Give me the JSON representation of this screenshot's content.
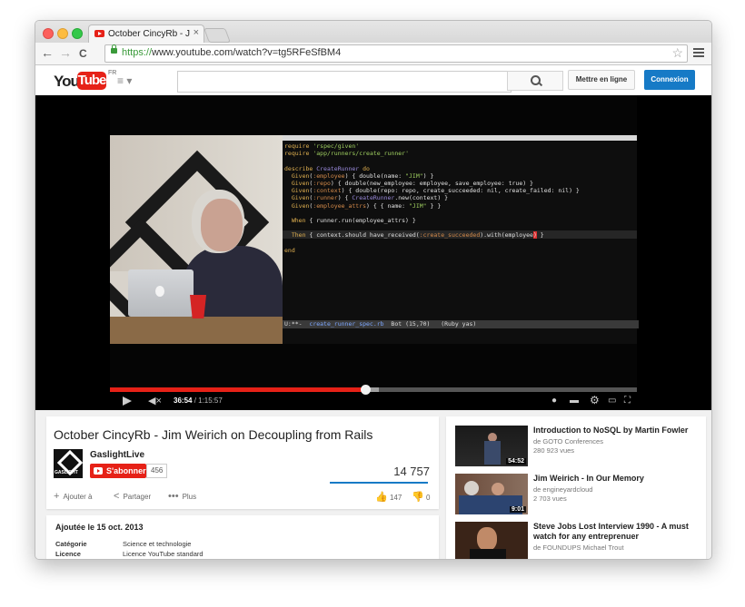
{
  "browser": {
    "tab_title": "October CincyRb - Jim Weir",
    "tab_close": "×",
    "url_scheme": "https://",
    "url_rest": "www.youtube.com/watch?v=tg5RFeSfBM4",
    "back": "←",
    "forward": "→",
    "reload": "C",
    "star": "☆"
  },
  "masthead": {
    "logo_you": "You",
    "logo_tube": "Tube",
    "logo_region": "FR",
    "guide": "≡ ▾",
    "search_placeholder": "",
    "upload_label": "Mettre en ligne",
    "signin_label": "Connexion"
  },
  "player": {
    "code_lines": [
      "require 'rspec/given'",
      "require 'app/runners/create_runner'",
      "",
      "describe CreateRunner do",
      "  Given(:employee) { double(name: \"JIM\") }",
      "  Given(:repo) { double(new_employee: employee, save_employee: true) }",
      "  Given(:context) { double(repo: repo, create_succeeded: nil, create_failed: nil) }",
      "  Given(:runner) { CreateRunner.new(context) }",
      "  Given(:employee_attrs) { { name: \"JIM\" } }",
      "",
      "  When { runner.run(employee_attrs) }",
      "",
      "  Then { context.should have_received(:create_succeeded).with(employee) }",
      "",
      "end"
    ],
    "modeline_prefix": "U:**-  ",
    "modeline_file": "create_runner_spec.rb",
    "modeline_rest": "  Bot (15,70)   (Ruby yas)",
    "time_current": "36:54",
    "time_total": " / 1:15:57",
    "progress_played": 0.485,
    "progress_buffered": 0.51
  },
  "video": {
    "title": "October CincyRb - Jim Weirich on Decoupling from Rails",
    "channel_logo_text": "GASLIGHT",
    "channel": "GaslightLive",
    "subscribe_label": "S'abonner",
    "subscriber_count": "456",
    "views": "14 757",
    "actions": [
      {
        "icon": "+",
        "label": "Ajouter à"
      },
      {
        "icon": "<",
        "label": "Partager"
      },
      {
        "icon": "•••",
        "label": "Plus"
      }
    ],
    "likes": "147",
    "dislikes": "0",
    "published": "Ajoutée le 15 oct. 2013",
    "meta": [
      {
        "key": "Catégorie",
        "value": "Science et technologie"
      },
      {
        "key": "Licence",
        "value": "Licence YouTube standard"
      }
    ]
  },
  "related": [
    {
      "title": "Introduction to NoSQL by Martin Fowler",
      "channel": "de GOTO Conferences",
      "views": "280 923 vues",
      "duration": "54:52"
    },
    {
      "title": "Jim Weirich - In Our Memory",
      "channel": "de engineyardcloud",
      "views": "2 703 vues",
      "duration": "9:01"
    },
    {
      "title": "Steve Jobs Lost Interview 1990 - A must watch for any entreprenuer",
      "channel": "de FOUNDUPS Michael Trout",
      "views": "",
      "duration": ""
    }
  ]
}
